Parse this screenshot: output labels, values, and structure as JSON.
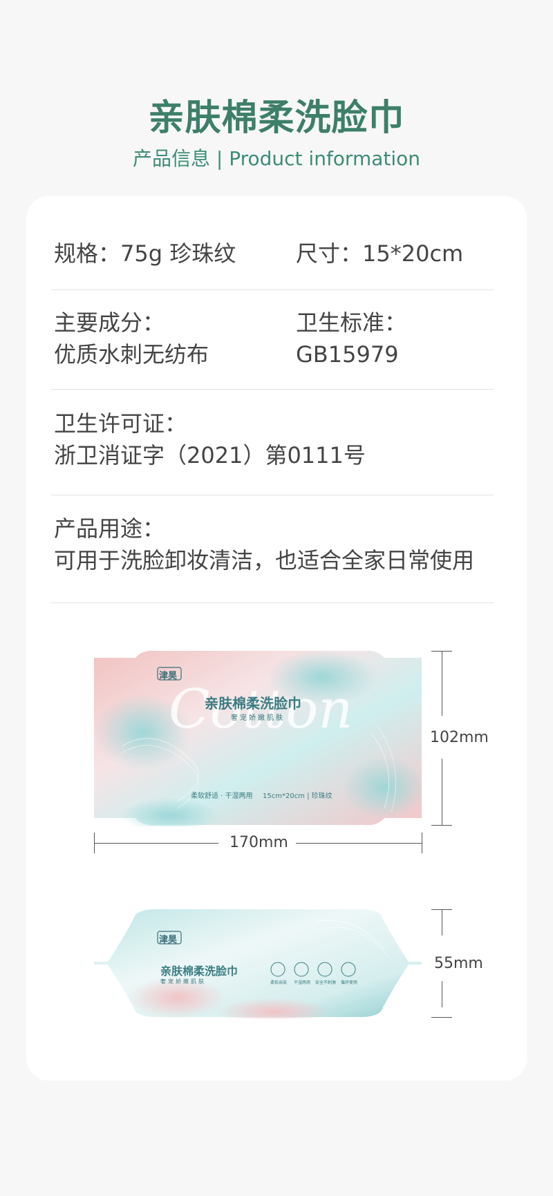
{
  "header": {
    "title": "亲肤棉柔洗脸巾",
    "subtitle": "产品信息 | Product information"
  },
  "specs": {
    "spec_label": "规格：",
    "spec_value": "75g 珍珠纹",
    "size_label": "尺寸：",
    "size_value": "15*20cm",
    "ingredient_label": "主要成分：",
    "ingredient_value": "优质水刺无纺布",
    "standard_label": "卫生标准：",
    "standard_value": "GB15979",
    "license_label": "卫生许可证：",
    "license_value": "浙卫消证字（2021）第0111号",
    "usage_label": "产品用途：",
    "usage_value": "可用于洗脸卸妆清洁，也适合全家日常使用"
  },
  "package_front": {
    "brand": "津昊",
    "script_text": "Cotton",
    "name": "亲肤棉柔洗脸巾",
    "slogan": "奢宠娇嫩肌肤",
    "feature_text": "柔软舒适 · 干湿两用",
    "size_text": "15cm*20cm | 珍珠纹",
    "height_dim": "102mm",
    "width_dim": "170mm"
  },
  "package_side": {
    "brand": "津昊",
    "name": "亲肤棉柔洗脸巾",
    "slogan": "奢宠娇嫩肌肤",
    "icons": [
      "柔软亲肤",
      "干湿两用",
      "安全不刺激",
      "循环使用"
    ],
    "depth_dim": "55mm"
  },
  "colors": {
    "title_green": "#3d7f68",
    "package_teal": "#a9dcdc",
    "package_pink": "#f3c6c6"
  }
}
